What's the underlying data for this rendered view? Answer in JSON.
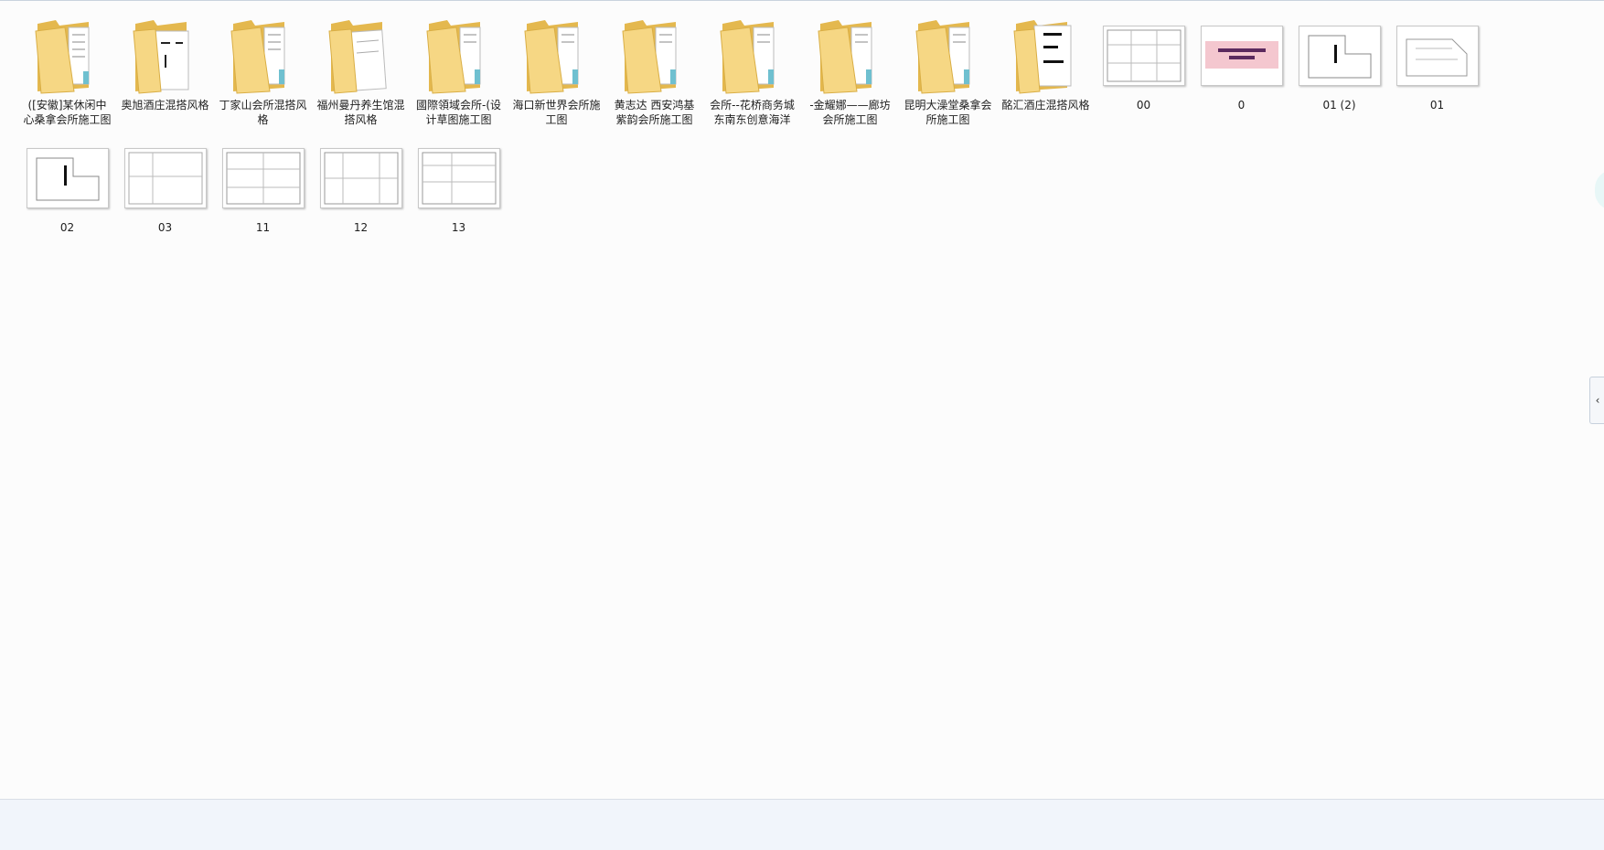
{
  "folders": [
    {
      "label": "([安徽]某休闲中心桑拿会所施工图"
    },
    {
      "label": "奥旭酒庄混搭风格"
    },
    {
      "label": "丁家山会所混搭风格"
    },
    {
      "label": "福州曼丹养生馆混搭风格"
    },
    {
      "label": "國際領域会所-(设计草图施工图"
    },
    {
      "label": "海口新世界会所施工图"
    },
    {
      "label": "黄志达 西安鸿基紫韵会所施工图"
    },
    {
      "label": "会所--花桥商务城东南东创意海洋"
    },
    {
      "label": "-金耀娜——廊坊会所施工图"
    },
    {
      "label": "昆明大澡堂桑拿会所施工图"
    },
    {
      "label": "酩汇酒庄混搭风格"
    }
  ],
  "images": [
    {
      "label": "00"
    },
    {
      "label": "0"
    },
    {
      "label": "01 (2)"
    },
    {
      "label": "01"
    },
    {
      "label": "02"
    },
    {
      "label": "03"
    },
    {
      "label": "11"
    },
    {
      "label": "12"
    },
    {
      "label": "13"
    }
  ],
  "side_tab": {
    "glyph": "‹"
  },
  "colors": {
    "folder_front": "#f5d682",
    "folder_back": "#e9bf58",
    "background": "#fcfcfc"
  }
}
